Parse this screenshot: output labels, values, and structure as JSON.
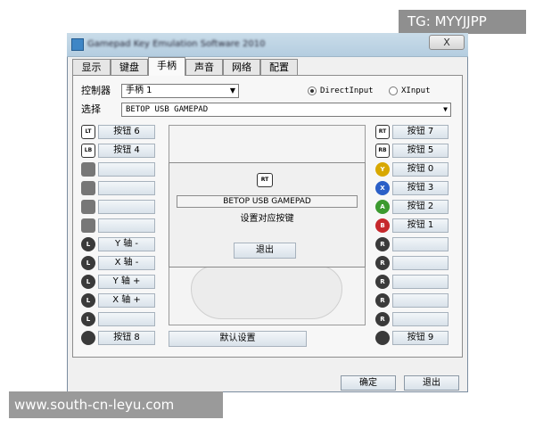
{
  "watermarks": {
    "top_right": "TG: MYYJJPP",
    "bottom_left": "www.south-cn-leyu.com"
  },
  "window": {
    "title": "Gamepad Key Emulation Software 2010",
    "close_label": "X"
  },
  "tabs": [
    "显示",
    "键盘",
    "手柄",
    "声音",
    "网络",
    "配置"
  ],
  "controller": {
    "label": "控制器",
    "value": "手柄 1",
    "select_label": "选择",
    "select_value": "BETOP USB GAMEPAD"
  },
  "mode": {
    "directinput": "DirectInput",
    "xinput": "XInput",
    "selected": "DirectInput"
  },
  "left_buttons": [
    {
      "icon": "lt-icon",
      "icon_text": "LT",
      "label": "按钮 6"
    },
    {
      "icon": "lb-icon",
      "icon_text": "LB",
      "label": "按钮 4"
    },
    {
      "icon": "dpad-up-icon",
      "icon_text": "",
      "label": ""
    },
    {
      "icon": "dpad-left-icon",
      "icon_text": "",
      "label": ""
    },
    {
      "icon": "dpad-down-icon",
      "icon_text": "",
      "label": ""
    },
    {
      "icon": "dpad-right-icon",
      "icon_text": "",
      "label": ""
    },
    {
      "icon": "left-stick-up-icon",
      "icon_text": "L",
      "label": "Y 轴 -"
    },
    {
      "icon": "left-stick-left-icon",
      "icon_text": "L",
      "label": "X 轴 -"
    },
    {
      "icon": "left-stick-down-icon",
      "icon_text": "L",
      "label": "Y 轴 +"
    },
    {
      "icon": "left-stick-right-icon",
      "icon_text": "L",
      "label": "X 轴 +"
    },
    {
      "icon": "left-stick-press-icon",
      "icon_text": "L",
      "label": ""
    },
    {
      "icon": "back-icon",
      "icon_text": "",
      "label": "按钮 8"
    }
  ],
  "right_buttons": [
    {
      "icon": "rt-icon",
      "icon_text": "RT",
      "label": "按钮 7"
    },
    {
      "icon": "rb-icon",
      "icon_text": "RB",
      "label": "按钮 5"
    },
    {
      "icon": "y-button-icon",
      "icon_text": "Y",
      "label": "按钮 0"
    },
    {
      "icon": "x-button-icon",
      "icon_text": "X",
      "label": "按钮 3"
    },
    {
      "icon": "a-button-icon",
      "icon_text": "A",
      "label": "按钮 2"
    },
    {
      "icon": "b-button-icon",
      "icon_text": "B",
      "label": "按钮 1"
    },
    {
      "icon": "right-stick-up-icon",
      "icon_text": "R",
      "label": ""
    },
    {
      "icon": "right-stick-left-icon",
      "icon_text": "R",
      "label": ""
    },
    {
      "icon": "right-stick-down-icon",
      "icon_text": "R",
      "label": ""
    },
    {
      "icon": "right-stick-right-icon",
      "icon_text": "R",
      "label": ""
    },
    {
      "icon": "right-stick-press-icon",
      "icon_text": "R",
      "label": ""
    },
    {
      "icon": "start-icon",
      "icon_text": "",
      "label": "按钮 9"
    }
  ],
  "dialog": {
    "icon_text": "RT",
    "device": "BETOP USB GAMEPAD",
    "prompt": "设置对应按键",
    "exit_label": "退出"
  },
  "default_label": "默认设置",
  "footer": {
    "ok_label": "确定",
    "exit_label": "退出"
  }
}
